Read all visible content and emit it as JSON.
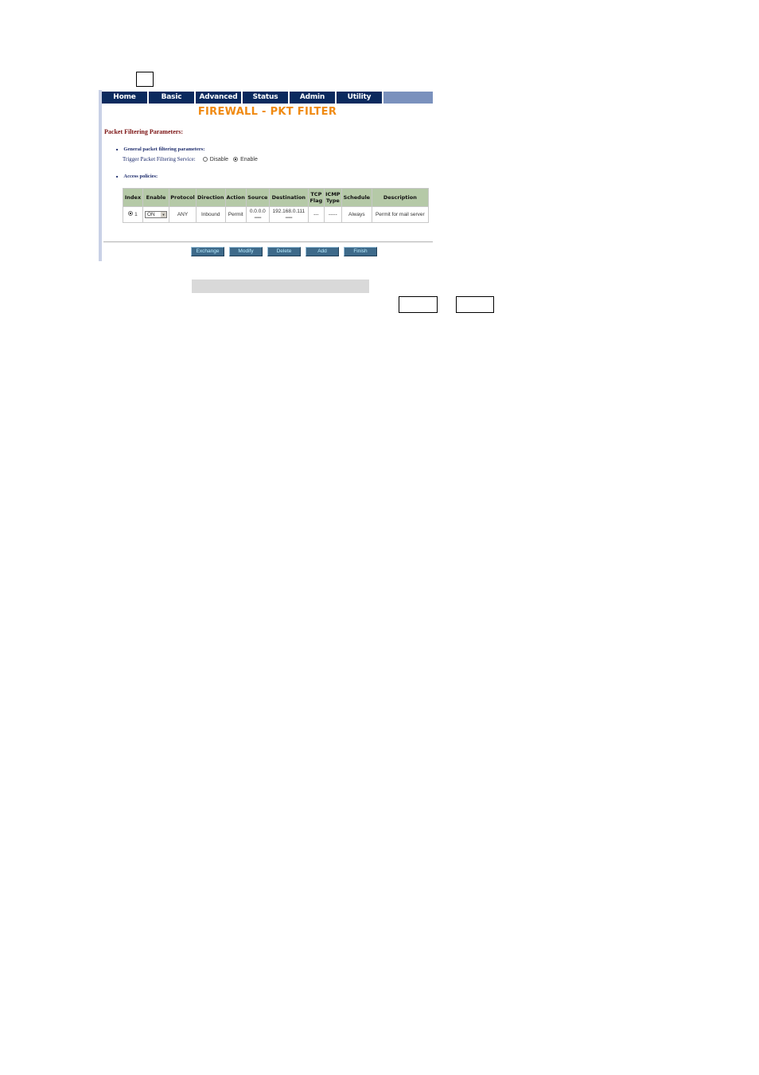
{
  "nav": {
    "items": [
      {
        "label": "Home"
      },
      {
        "label": "Basic"
      },
      {
        "label": "Advanced"
      },
      {
        "label": "Status"
      },
      {
        "label": "Admin"
      },
      {
        "label": "Utility"
      }
    ]
  },
  "page": {
    "title": "FIREWALL - PKT FILTER",
    "section_title": "Packet Filtering Parameters:"
  },
  "general": {
    "heading": "General packet filtering parameters:",
    "trigger_label": "Trigger Packet Filtering Service:",
    "options": [
      {
        "label": "Disable",
        "selected": false
      },
      {
        "label": "Enable",
        "selected": true
      }
    ]
  },
  "policies": {
    "heading": "Access policies:",
    "columns": [
      "Index",
      "Enable",
      "Protocol",
      "Direction",
      "Action",
      "Source",
      "Destination",
      "TCP Flag",
      "ICMP Type",
      "Schedule",
      "Description"
    ],
    "rows": [
      {
        "index": "1",
        "selected": true,
        "enable": "ON",
        "protocol": "ANY",
        "direction": "Inbound",
        "action": "Permit",
        "source": "0.0.0.0",
        "source_sub": "-----",
        "destination": "192.168.0.111",
        "destination_sub": "-----",
        "tcp_flag": "---",
        "icmp_type": "-----",
        "schedule": "Always",
        "description": "Permit for mail server"
      }
    ]
  },
  "buttons": {
    "exchange": "Exchange",
    "modify": "Modify",
    "delete": "Delete",
    "add": "Add",
    "finish": "Finish"
  },
  "colors": {
    "nav_bg": "#0b2a5e",
    "title": "#f08a12",
    "header_cell": "#b5c9a7",
    "button": "#3e6a8a"
  }
}
